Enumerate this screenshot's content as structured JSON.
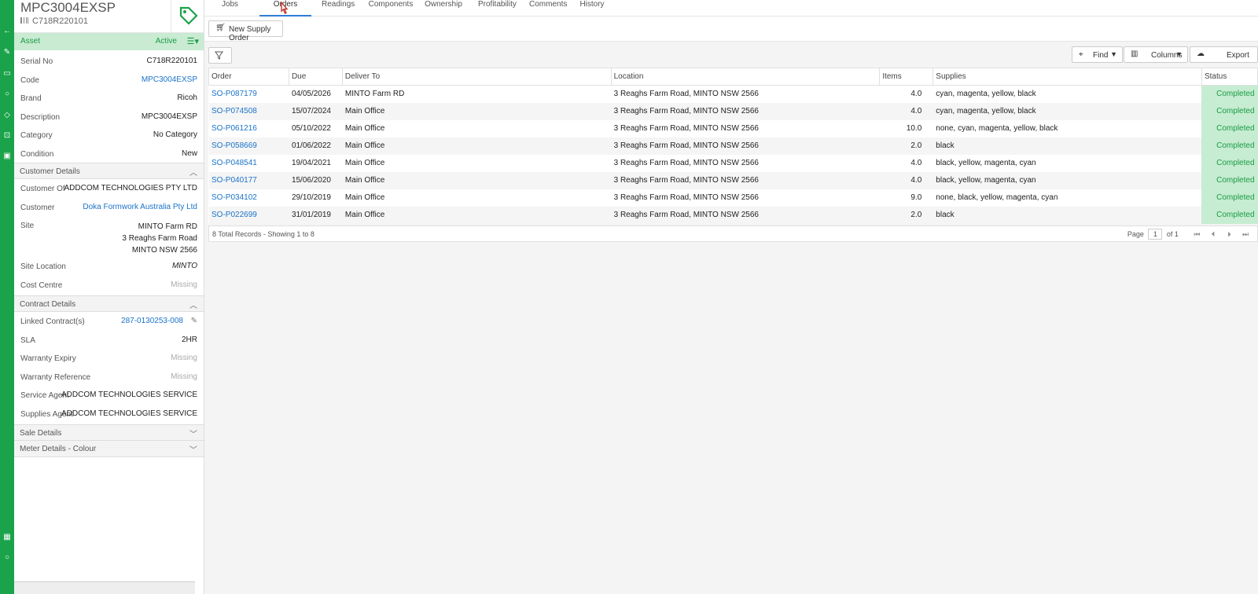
{
  "asset": {
    "title": "MPC3004EXSP",
    "serial_header": "C718R220101",
    "bar_label": "Asset",
    "status": "Active"
  },
  "details": [
    {
      "key": "Serial No",
      "value": "C718R220101"
    },
    {
      "key": "Code",
      "value": "MPC3004EXSP"
    },
    {
      "key": "Brand",
      "value": "Ricoh"
    },
    {
      "key": "Description",
      "value": "MPC3004EXSP"
    },
    {
      "key": "Category",
      "value": "No Category"
    },
    {
      "key": "Condition",
      "value": "New"
    }
  ],
  "customer_section": {
    "title": "Customer Details",
    "customer_of_label": "Customer Of",
    "customer_of": "ADDCOM TECHNOLOGIES PTY LTD",
    "customer_label": "Customer",
    "customer": "Doka Formwork Australia Pty Ltd",
    "site_label": "Site",
    "site_line1": "MINTO Farm RD",
    "site_line2": "3 Reaghs Farm Road",
    "site_line3": "MINTO NSW 2566",
    "site_location_label": "Site Location",
    "site_location": "MINTO",
    "cost_centre_label": "Cost Centre",
    "cost_centre": "Missing"
  },
  "contract_section": {
    "title": "Contract Details",
    "linked_label": "Linked Contract(s)",
    "linked": "287-0130253-008",
    "sla_label": "SLA",
    "sla": "2HR",
    "warranty_expiry_label": "Warranty Expiry",
    "warranty_expiry": "Missing",
    "warranty_ref_label": "Warranty Reference",
    "warranty_ref": "Missing",
    "service_agent_label": "Service Agent",
    "service_agent": "ADDCOM TECHNOLOGIES SERVICE",
    "supplies_agent_label": "Supplies Agent",
    "supplies_agent": "ADDCOM TECHNOLOGIES SERVICE"
  },
  "sale_section": {
    "title": "Sale Details"
  },
  "meter_section": {
    "title": "Meter Details - Colour"
  },
  "tabs": [
    "Jobs",
    "Orders",
    "Readings",
    "Components",
    "Ownership",
    "Profitability",
    "Comments",
    "History"
  ],
  "toolbar": {
    "new_supply_order": "New Supply Order"
  },
  "grid_tools": {
    "find": "Find",
    "columns": "Columns",
    "export": "Export"
  },
  "columns": [
    "Order",
    "Due",
    "Deliver To",
    "Location",
    "Items",
    "Supplies",
    "Status"
  ],
  "rows": [
    [
      "SO-P087179",
      "04/05/2026",
      "MINTO Farm RD",
      "3 Reaghs Farm Road, MINTO NSW 2566",
      "4.0",
      "cyan, magenta, yellow, black",
      "Completed"
    ],
    [
      "SO-P074508",
      "15/07/2024",
      "Main Office",
      "3 Reaghs Farm Road, MINTO NSW 2566",
      "4.0",
      "cyan, magenta, yellow, black",
      "Completed"
    ],
    [
      "SO-P061216",
      "05/10/2022",
      "Main Office",
      "3 Reaghs Farm Road, MINTO NSW 2566",
      "10.0",
      "none, cyan, magenta, yellow, black",
      "Completed"
    ],
    [
      "SO-P058669",
      "01/06/2022",
      "Main Office",
      "3 Reaghs Farm Road, MINTO NSW 2566",
      "2.0",
      "black",
      "Completed"
    ],
    [
      "SO-P048541",
      "19/04/2021",
      "Main Office",
      "3 Reaghs Farm Road, MINTO NSW 2566",
      "4.0",
      "black, yellow, magenta, cyan",
      "Completed"
    ],
    [
      "SO-P040177",
      "15/06/2020",
      "Main Office",
      "3 Reaghs Farm Road, MINTO NSW 2566",
      "4.0",
      "black, yellow, magenta, cyan",
      "Completed"
    ],
    [
      "SO-P034102",
      "29/10/2019",
      "Main Office",
      "3 Reaghs Farm Road, MINTO NSW 2566",
      "9.0",
      "none, black, yellow, magenta, cyan",
      "Completed"
    ],
    [
      "SO-P022699",
      "31/01/2019",
      "Main Office",
      "3 Reaghs Farm Road, MINTO NSW 2566",
      "2.0",
      "black",
      "Completed"
    ]
  ],
  "footer": {
    "records": "8 Total Records - Showing 1 to 8",
    "page_label": "Page",
    "page": "1",
    "of": "of 1"
  },
  "colors": {
    "rail": "#1aa34a",
    "accent": "#2d7fd4",
    "status": "#1a9b45"
  }
}
